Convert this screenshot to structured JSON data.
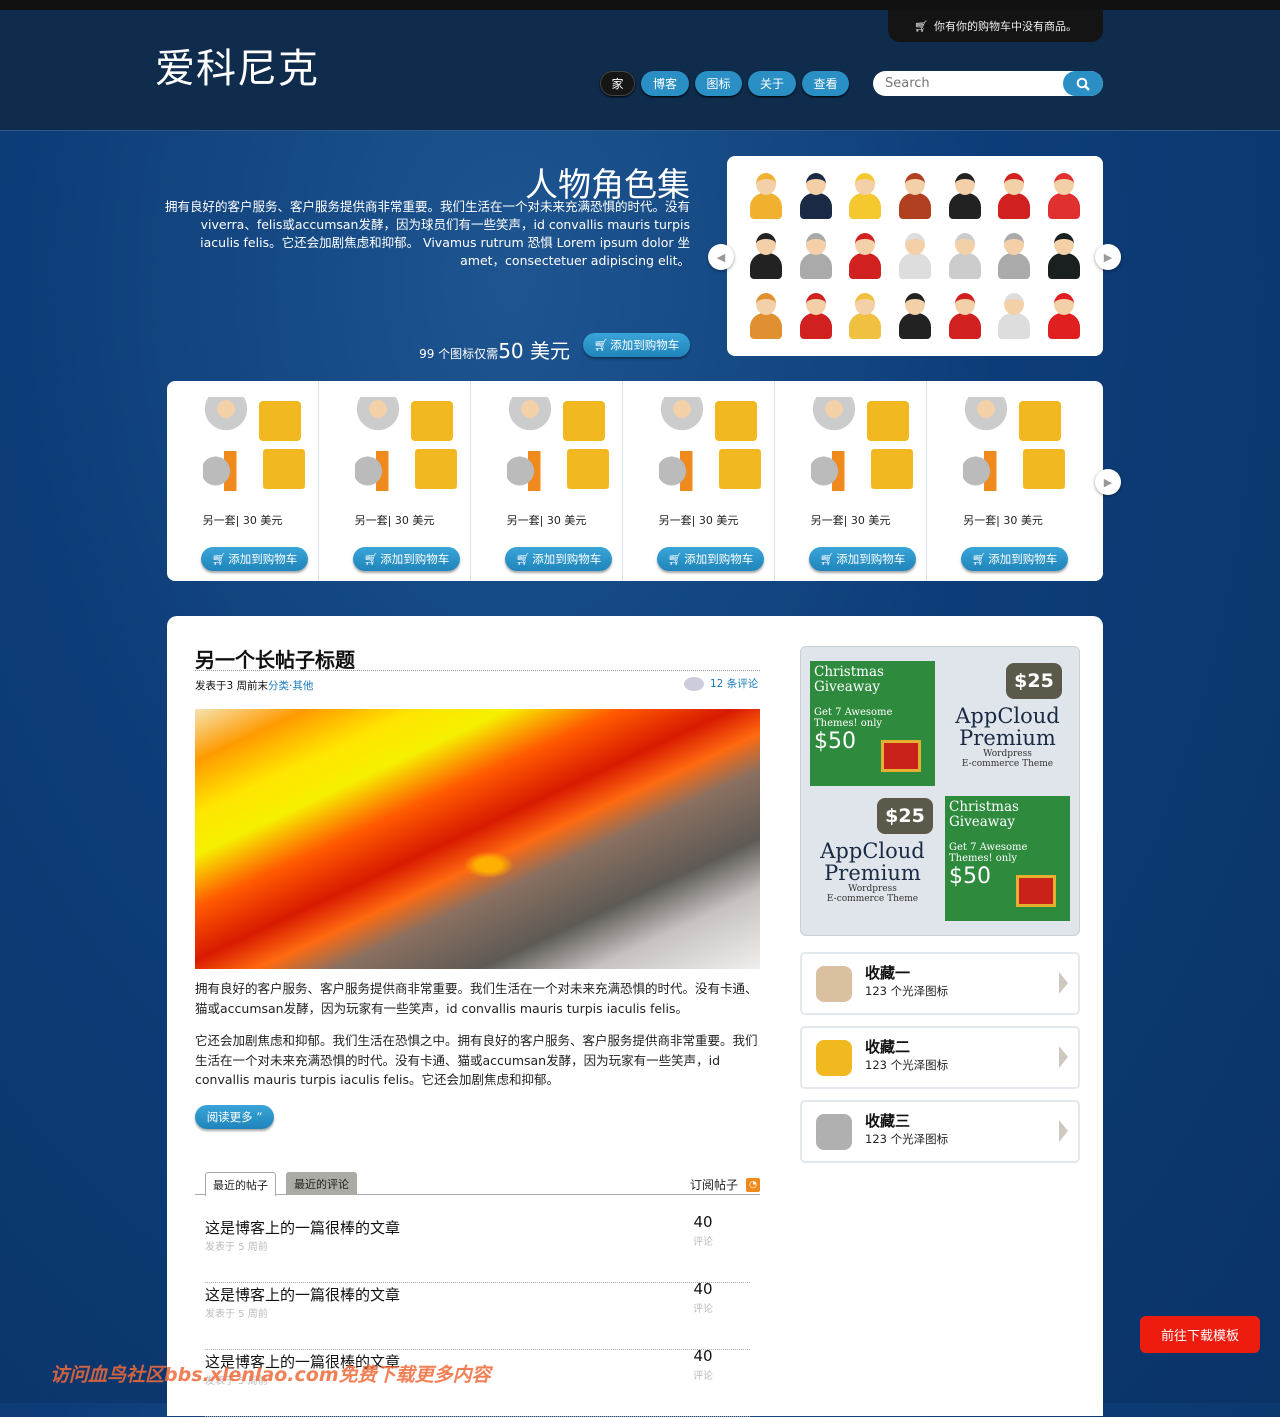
{
  "header": {
    "logo": "爱科尼克",
    "cart_message": "你有你的购物车中没有商品。",
    "nav": [
      {
        "label": "家",
        "active": true
      },
      {
        "label": "博客"
      },
      {
        "label": "图标"
      },
      {
        "label": "关于"
      },
      {
        "label": "查看"
      }
    ],
    "search": {
      "placeholder": "Search",
      "value": ""
    }
  },
  "hero": {
    "title": "人物角色集",
    "text": "拥有良好的客户服务、客户服务提供商非常重要。我们生活在一个对未来充满恐惧的时代。没有viverra、felis或accumsan发酵，因为球员们有一些笑声，id convallis mauris turpis iaculis felis。它还会加剧焦虑和抑郁。 Vivamus rutrum 恐惧 Lorem ipsum dolor 坐 amet，consectetuer adipiscing elit。",
    "price_prefix": "99 个图标仅需",
    "price": "50 美元",
    "add_to_cart": "添加到购物车",
    "characters": [
      "#f0b030",
      "#1a2a44",
      "#f5c830",
      "#b04020",
      "#222",
      "#d02020",
      "#e03030",
      "#222",
      "#aaa",
      "#d02020",
      "#ddd",
      "#ccc",
      "#aaa",
      "#1a2020",
      "#e09030",
      "#d02020",
      "#f0c040",
      "#222",
      "#d02020",
      "#ddd",
      "#e02020"
    ]
  },
  "products": [
    {
      "label": "另一套| 30 美元",
      "button": "添加到购物车"
    },
    {
      "label": "另一套| 30 美元",
      "button": "添加到购物车"
    },
    {
      "label": "另一套| 30 美元",
      "button": "添加到购物车"
    },
    {
      "label": "另一套| 30 美元",
      "button": "添加到购物车"
    },
    {
      "label": "另一套| 30 美元",
      "button": "添加到购物车"
    },
    {
      "label": "另一套| 30 美元",
      "button": "添加到购物车"
    }
  ],
  "post": {
    "title": "另一个长帖子标题",
    "meta_prefix": "发表于3 周前末",
    "category": "分类·其他",
    "comments": "12 条评论",
    "para1": "拥有良好的客户服务、客户服务提供商非常重要。我们生活在一个对未来充满恐惧的时代。没有卡通、猫或accumsan发酵，因为玩家有一些笑声，id convallis mauris turpis iaculis felis。",
    "para2": "它还会加剧焦虑和抑郁。我们生活在恐惧之中。拥有良好的客户服务、客户服务提供商非常重要。我们生活在一个对未来充满恐惧的时代。没有卡通、猫或accumsan发酵，因为玩家有一些笑声，id convallis mauris turpis iaculis felis。它还会加剧焦虑和抑郁。",
    "read_more": "阅读更多 ”"
  },
  "recent": {
    "tabs": [
      "最近的帖子",
      "最近的评论"
    ],
    "subscribe": "订阅帖子",
    "items": [
      {
        "title": "这是博客上的一篇很棒的文章",
        "date": "发表于 5 周前",
        "count": "40",
        "count_label": "评论"
      },
      {
        "title": "这是博客上的一篇很棒的文章",
        "date": "发表于 5 周前",
        "count": "40",
        "count_label": "评论"
      },
      {
        "title": "这是博客上的一篇很棒的文章",
        "date": "发表于 5 周前",
        "count": "40",
        "count_label": "评论"
      }
    ]
  },
  "ads": {
    "green": {
      "title1": "Christmas",
      "title2": "Giveaway",
      "get": "Get 7 Awesome Themes! only",
      "price": "$50"
    },
    "blue": {
      "badge": "$25",
      "name1": "AppCloud",
      "name2": "Premium",
      "sub1": "Wordpress",
      "sub2": "E-commerce Theme"
    }
  },
  "collections": [
    {
      "title": "收藏一",
      "sub": "123 个光泽图标",
      "color": "#d8c0a0"
    },
    {
      "title": "收藏二",
      "sub": "123 个光泽图标",
      "color": "#f2b820"
    },
    {
      "title": "收藏三",
      "sub": "123 个光泽图标",
      "color": "#b0b0b0"
    }
  ],
  "watermark": "访问血鸟社区bbs.xlenlao.com免费下载更多内容",
  "download_button": "前往下载模板",
  "colors": {
    "accent": "#2a8fc4",
    "header": "#0f2c4d",
    "download": "#ee1c0e"
  }
}
